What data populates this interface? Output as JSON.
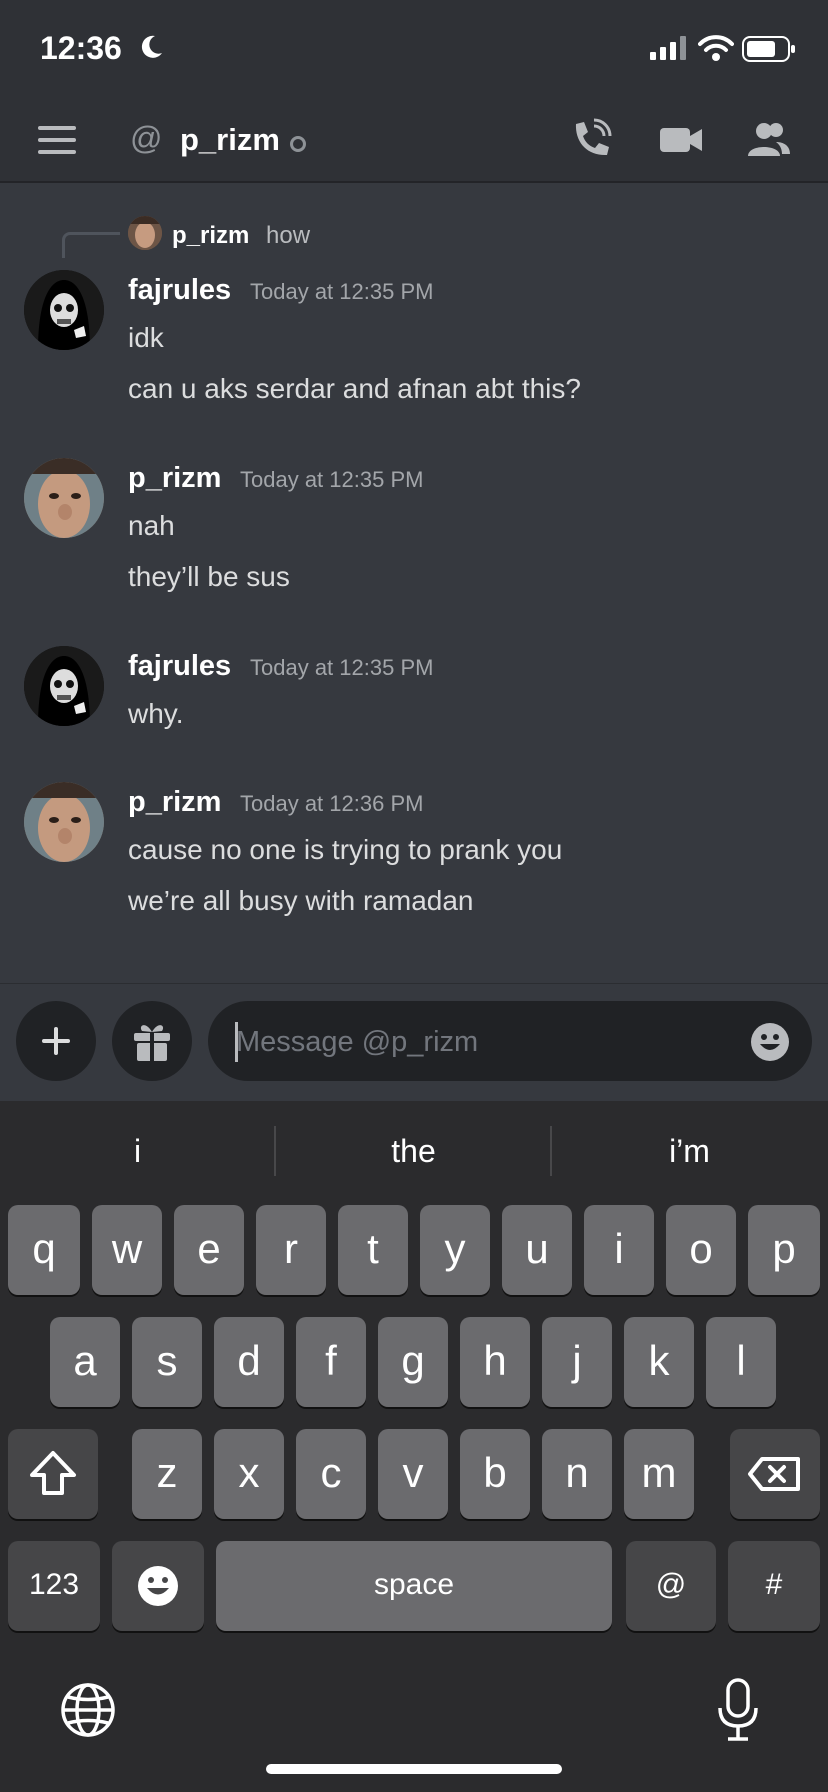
{
  "status_bar": {
    "time": "12:36"
  },
  "header": {
    "at_symbol": "@",
    "dm_name": "p_rizm"
  },
  "reply": {
    "name": "p_rizm",
    "text": "how"
  },
  "messages": [
    {
      "author": "fajrules",
      "time": "Today at 12:35 PM",
      "lines": [
        "idk",
        "can u aks serdar and afnan abt this?"
      ]
    },
    {
      "author": "p_rizm",
      "time": "Today at 12:35 PM",
      "lines": [
        "nah",
        "they’ll be sus"
      ]
    },
    {
      "author": "fajrules",
      "time": "Today at 12:35 PM",
      "lines": [
        "why."
      ]
    },
    {
      "author": "p_rizm",
      "time": "Today at 12:36 PM",
      "lines": [
        "cause no one is trying to prank you",
        "we’re all busy with ramadan"
      ]
    }
  ],
  "composer": {
    "placeholder": "Message @p_rizm"
  },
  "keyboard": {
    "suggestions": [
      "i",
      "the",
      "i’m"
    ],
    "row1": [
      "q",
      "w",
      "e",
      "r",
      "t",
      "y",
      "u",
      "i",
      "o",
      "p"
    ],
    "row2": [
      "a",
      "s",
      "d",
      "f",
      "g",
      "h",
      "j",
      "k",
      "l"
    ],
    "row3": [
      "z",
      "x",
      "c",
      "v",
      "b",
      "n",
      "m"
    ],
    "numbers_key": "123",
    "space_key": "space",
    "at_key": "@",
    "hash_key": "#"
  },
  "colors": {
    "background": "#36393f",
    "header": "#2f3136",
    "input": "#202225",
    "key": "#6b6b6e"
  }
}
